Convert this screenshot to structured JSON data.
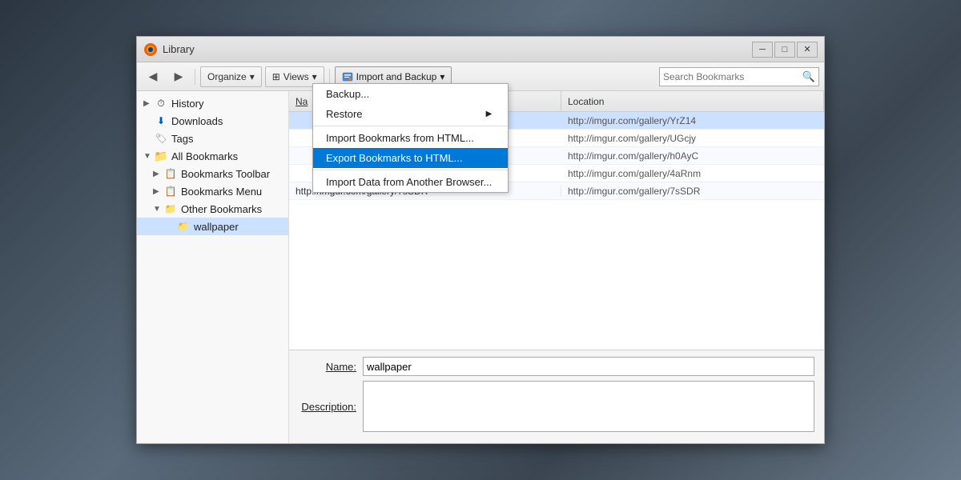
{
  "background": {
    "description": "Dark mechanical background"
  },
  "window": {
    "title": "Library",
    "title_icon": "🦊"
  },
  "title_buttons": {
    "minimize": "─",
    "maximize": "□",
    "close": "✕"
  },
  "toolbar": {
    "back_label": "◀",
    "forward_label": "▶",
    "organize_label": "Organize",
    "organize_arrow": "▾",
    "views_label": "Views",
    "views_arrow": "▾",
    "import_backup_label": "Import and Backup",
    "import_backup_arrow": "▾",
    "search_placeholder": "Search Bookmarks"
  },
  "sidebar": {
    "items": [
      {
        "id": "history",
        "label": "History",
        "icon": "⏱",
        "arrow": "▶",
        "indent": 0
      },
      {
        "id": "downloads",
        "label": "Downloads",
        "icon": "⬇",
        "indent": 0
      },
      {
        "id": "tags",
        "label": "Tags",
        "icon": "🏷",
        "indent": 0
      },
      {
        "id": "all-bookmarks",
        "label": "All Bookmarks",
        "icon": "📁",
        "arrow": "▼",
        "indent": 0
      },
      {
        "id": "bookmarks-toolbar",
        "label": "Bookmarks Toolbar",
        "icon": "📋",
        "arrow": "▶",
        "indent": 1
      },
      {
        "id": "bookmarks-menu",
        "label": "Bookmarks Menu",
        "icon": "📋",
        "arrow": "▶",
        "indent": 1
      },
      {
        "id": "other-bookmarks",
        "label": "Other Bookmarks",
        "icon": "📁",
        "arrow": "▼",
        "indent": 1
      },
      {
        "id": "wallpaper",
        "label": "wallpaper",
        "icon": "📁",
        "indent": 2,
        "selected": true
      }
    ]
  },
  "table": {
    "columns": [
      {
        "id": "name",
        "label": "Na"
      },
      {
        "id": "location",
        "label": "Location"
      }
    ],
    "rows": [
      {
        "name": "",
        "location": "http://imgur.com/gallery/YrZ14",
        "highlighted": true
      },
      {
        "name": "",
        "location": "http://imgur.com/gallery/UGcjy"
      },
      {
        "name": "",
        "location": "http://imgur.com/gallery/h0AyC"
      },
      {
        "name": "",
        "location": "http://imgur.com/gallery/4aRnm"
      },
      {
        "name": "http://imgur.com/gallery/7sSDR",
        "location": "http://imgur.com/gallery/7sSDR"
      }
    ]
  },
  "bottom_panel": {
    "name_label": "Name:",
    "name_value": "wallpaper",
    "description_label": "Description:",
    "description_value": ""
  },
  "dropdown_menu": {
    "items": [
      {
        "id": "backup",
        "label": "Backup...",
        "has_submenu": false
      },
      {
        "id": "restore",
        "label": "Restore",
        "has_submenu": true
      },
      {
        "id": "import-html",
        "label": "Import Bookmarks from HTML...",
        "has_submenu": false
      },
      {
        "id": "export-html",
        "label": "Export Bookmarks to HTML...",
        "has_submenu": false,
        "highlighted": true
      },
      {
        "id": "import-browser",
        "label": "Import Data from Another Browser...",
        "has_submenu": false
      }
    ]
  }
}
